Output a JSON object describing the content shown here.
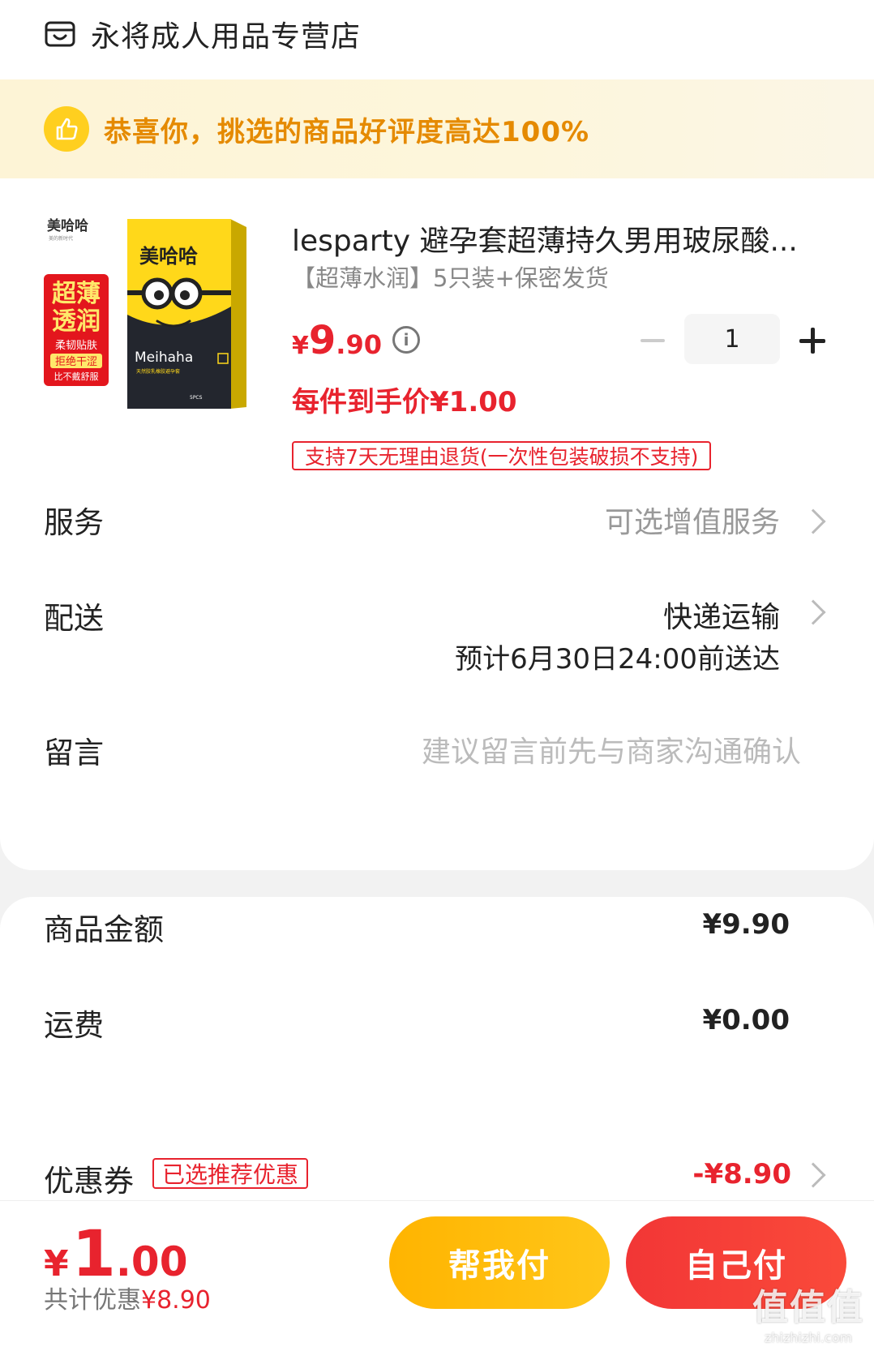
{
  "store": {
    "name": "永将成人用品专营店",
    "icon": "store-icon"
  },
  "promo": {
    "text": "恭喜你，挑选的商品好评度高达100%",
    "icon": "thumbs-up-icon",
    "color": "#e58a00"
  },
  "product": {
    "image_labels": {
      "brand_cn": "美哈哈",
      "brand_tagline": "美的新时代",
      "badge_line1": "超薄",
      "badge_line2": "透润",
      "badge_line3": "柔韧贴肤",
      "badge_line4": "拒绝干涩",
      "badge_line5": "比不戴舒服",
      "box_brand": "Meihaha",
      "box_sub": "天然胶乳橡胶避孕套",
      "box_count": "5PCS"
    },
    "title": "lesparty 避孕套超薄持久男用玻尿酸...",
    "spec": "【超薄水润】5只装+保密发货",
    "price_symbol": "¥",
    "price_int": "9",
    "price_dec": ".90",
    "info_icon": "info-icon",
    "each_price": "每件到手价¥1.00",
    "return_policy": "支持7天无理由退货(一次性包装破损不支持)",
    "quantity": "1"
  },
  "rows": {
    "service_label": "服务",
    "service_value": "可选增值服务",
    "delivery_label": "配送",
    "delivery_value": "快递运输",
    "delivery_eta": "预计6月30日24:00前送达",
    "message_label": "留言",
    "message_placeholder": "建议留言前先与商家沟通确认"
  },
  "summary": {
    "goods_label": "商品金额",
    "goods_value": "¥9.90",
    "shipping_label": "运费",
    "shipping_value": "¥0.00",
    "coupon_label": "优惠券",
    "coupon_tag": "已选推荐优惠",
    "coupon_value": "-¥8.90"
  },
  "footer": {
    "total_symbol": "¥",
    "total_int": "1",
    "total_dec": ".00",
    "saving_prefix": "共计优惠",
    "saving_value": "¥8.90",
    "help_pay": "帮我付",
    "self_pay": "自己付"
  },
  "watermark": {
    "big": "值值值",
    "small": "zhizhizhi.com"
  },
  "colors": {
    "accent_red": "#e8232e",
    "accent_yellow": "#ffb400",
    "promo_bg": "#fdf4d6"
  }
}
